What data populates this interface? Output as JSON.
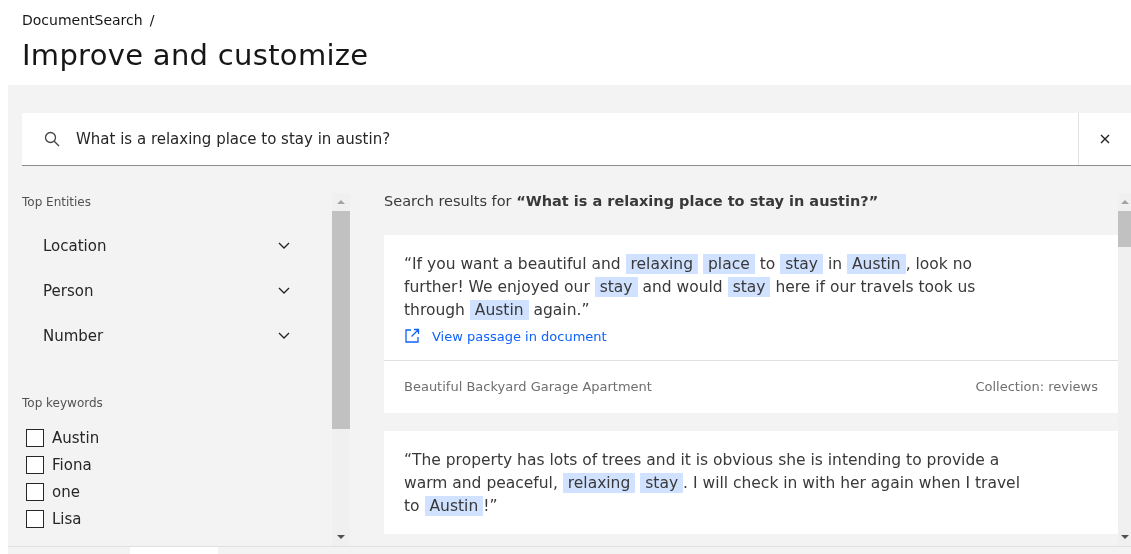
{
  "breadcrumb": "DocumentSearch",
  "breadcrumb_separator": "/",
  "page_title": "Improve and customize",
  "search": {
    "value": "What is a relaxing place to stay in austin?"
  },
  "sidebar": {
    "entities_heading": "Top Entities",
    "entities": [
      {
        "label": "Location",
        "expanded": false
      },
      {
        "label": "Person",
        "expanded": false
      },
      {
        "label": "Number",
        "expanded": false
      }
    ],
    "keywords_heading": "Top keywords",
    "keywords": [
      {
        "label": "Austin",
        "checked": false
      },
      {
        "label": "Fiona",
        "checked": false
      },
      {
        "label": "one",
        "checked": false
      },
      {
        "label": "Lisa",
        "checked": false
      }
    ]
  },
  "results": {
    "heading": "Search results for **“What is a relaxing place to stay in austin?”**",
    "items": [
      {
        "passage": [
          {
            "text": "“If you want a beautiful and ",
            "highlighted": false
          },
          {
            "text": "relaxing",
            "highlighted": true
          },
          {
            "text": "place",
            "highlighted": true
          },
          {
            "text": " to ",
            "highlighted": false
          },
          {
            "text": "stay",
            "highlighted": true
          },
          {
            "text": " in ",
            "highlighted": false
          },
          {
            "text": "Austin",
            "highlighted": true
          },
          {
            "text": ", look no further! We enjoyed our ",
            "highlighted": false
          },
          {
            "text": "stay",
            "highlighted": true
          },
          {
            "text": " and would ",
            "highlighted": false
          },
          {
            "text": "stay",
            "highlighted": true
          },
          {
            "text": " here if our travels took us through ",
            "highlighted": false
          },
          {
            "text": "Austin",
            "highlighted": true
          },
          {
            "text": " again.”",
            "highlighted": false
          }
        ],
        "link": "View passage in document",
        "title": "Beautiful Backyard Garage Apartment",
        "collection": "Collection: reviews"
      },
      {
        "passage": [
          {
            "text": "“The property has lots of trees and it is obvious she is intending to provide a warm and peaceful, ",
            "highlighted": false
          },
          {
            "text": "relaxing",
            "highlighted": true
          },
          {
            "text": "stay",
            "highlighted": true
          },
          {
            "text": ". I will check in with her again when I travel to ",
            "highlighted": false
          },
          {
            "text": "Austin",
            "highlighted": true
          },
          {
            "text": "!”",
            "highlighted": false
          }
        ]
      }
    ]
  }
}
